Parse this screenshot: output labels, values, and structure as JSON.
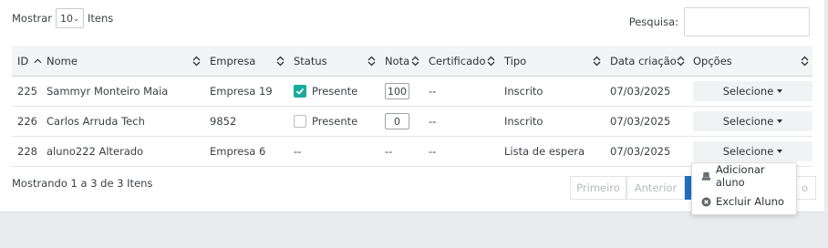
{
  "length": {
    "label_before": "Mostrar",
    "value": "10",
    "label_after": "Itens"
  },
  "search": {
    "label": "Pesquisa:",
    "value": ""
  },
  "columns": [
    "ID",
    "Nome",
    "Empresa",
    "Status",
    "Nota",
    "Certificado",
    "Tipo",
    "Data criação",
    "Opções"
  ],
  "rows": [
    {
      "id": "225",
      "nome": "Sammyr Monteiro Maia",
      "empresa": "Empresa 19",
      "status": "Presente",
      "status_checked": true,
      "nota": "100",
      "certificado": "--",
      "tipo": "Inscrito",
      "data": "07/03/2025",
      "opcoes": "Selecione"
    },
    {
      "id": "226",
      "nome": "Carlos Arruda Tech",
      "empresa": "9852",
      "status": "Presente",
      "status_checked": false,
      "nota": "0",
      "certificado": "--",
      "tipo": "Inscrito",
      "data": "07/03/2025",
      "opcoes": "Selecione"
    },
    {
      "id": "228",
      "nome": "aluno222 Alterado",
      "empresa": "Empresa 6",
      "status": "--",
      "nota": "--",
      "certificado": "--",
      "tipo": "Lista de espera",
      "data": "07/03/2025",
      "opcoes": "Selecione"
    }
  ],
  "footer": {
    "info": "Mostrando 1 a 3 de 3 Itens"
  },
  "pagination": {
    "first": "Primeiro",
    "prev": "Anterior",
    "last_partial": "o"
  },
  "dropdown": {
    "add": "Adicionar aluno",
    "remove": "Excluir Aluno"
  },
  "colors": {
    "accent": "#1f6fbf",
    "check": "#1aab9b"
  }
}
